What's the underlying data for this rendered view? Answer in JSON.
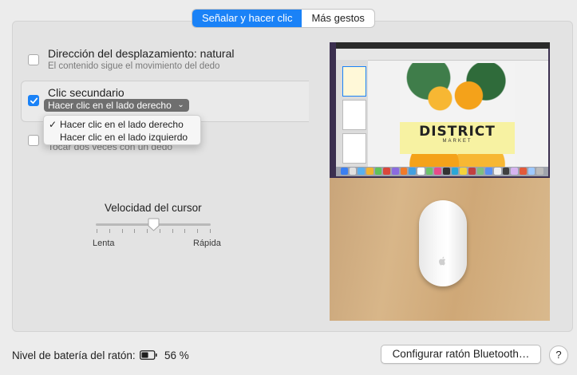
{
  "tabs": [
    {
      "label": "Señalar y hacer clic",
      "active": true
    },
    {
      "label": "Más gestos",
      "active": false
    }
  ],
  "options": {
    "scroll": {
      "title": "Dirección del desplazamiento: natural",
      "subtitle": "El contenido sigue el movimiento del dedo",
      "checked": false
    },
    "secondary_click": {
      "title": "Clic secundario",
      "selected": "Hacer clic en el lado derecho",
      "checked": true
    },
    "smart_zoom": {
      "subtitle": "Tocar dos veces con un dedo",
      "checked": false
    }
  },
  "dropdown_menu": {
    "items": [
      {
        "label": "Hacer clic en el lado derecho",
        "checked": true
      },
      {
        "label": "Hacer clic en el lado izquierdo",
        "checked": false
      }
    ]
  },
  "slider": {
    "title": "Velocidad del cursor",
    "min_label": "Lenta",
    "max_label": "Rápida",
    "value_fraction": 0.5
  },
  "preview": {
    "poster_title": "DISTRICT",
    "poster_subtitle": "MARKET"
  },
  "footer": {
    "battery_label": "Nivel de batería del ratón:",
    "battery_value": "56 %",
    "bluetooth_button": "Configurar ratón Bluetooth…",
    "help_label": "?"
  },
  "colors": {
    "accent": "#1a82f7",
    "popup": "#6f6f6f",
    "menu_bg": "#f6f6f6"
  }
}
